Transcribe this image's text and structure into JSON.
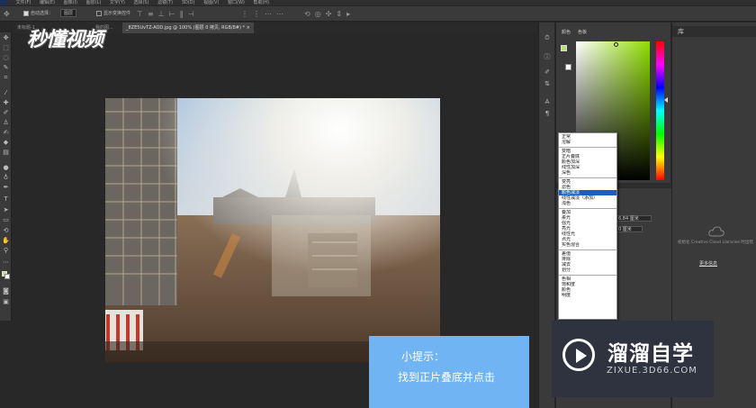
{
  "menubar": {
    "items": [
      "文件(F)",
      "编辑(E)",
      "图像(I)",
      "图层(L)",
      "文字(Y)",
      "选择(S)",
      "滤镜(T)",
      "3D(D)",
      "视图(V)",
      "窗口(W)",
      "帮助(H)"
    ]
  },
  "options": {
    "auto_select": "自动选择：",
    "auto_select_value": "图层",
    "show_transform": "显示变换控件"
  },
  "tabs": {
    "left": "未标题-1",
    "middle": "我的图...",
    "active": "_8ZE5UvTZ-AOD.jpg @ 100% (图层 0 拷贝, RGB/8#) *",
    "close": "×"
  },
  "watermark": {
    "miaodong": "秒懂视频"
  },
  "tip": {
    "title": "小提示：",
    "body": "找到正片叠底并点击"
  },
  "color_panel": {
    "tab_color": "颜色",
    "tab_swatches": "色板"
  },
  "properties": {
    "field1": "6.84 厘米",
    "field2": "0 厘米"
  },
  "blend_modes": {
    "groups": [
      [
        "正常",
        "溶解"
      ],
      [
        "变暗",
        "正片叠底",
        "颜色加深",
        "线性加深",
        "深色"
      ],
      [
        "变亮",
        "滤色",
        "颜色减淡",
        "线性减淡（添加）",
        "浅色"
      ],
      [
        "叠加",
        "柔光",
        "强光",
        "亮光",
        "线性光",
        "点光",
        "实色混合"
      ],
      [
        "差值",
        "排除",
        "减去",
        "划分"
      ],
      [
        "色相",
        "饱和度",
        "颜色",
        "明度"
      ]
    ],
    "selected": "颜色减淡"
  },
  "libraries": {
    "tab": "库",
    "message": "初始化 Creative Cloud Libraries 时出错",
    "more": "更多信息"
  },
  "brand": {
    "name": "溜溜自学",
    "url": "ZIXUE.3D66.COM"
  },
  "colors": {
    "tip_bg": "#70b4f3",
    "brand_bg": "#2f3340",
    "fg_swatch": "#c9e87a"
  }
}
